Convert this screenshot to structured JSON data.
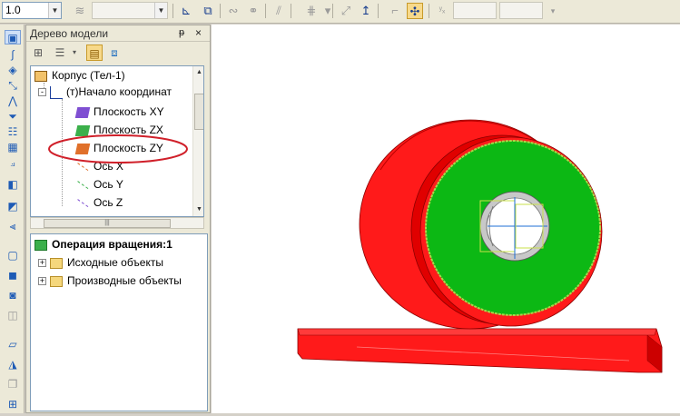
{
  "toolbar": {
    "line_scale_value": "1.0",
    "combo2_value": "",
    "combo3_value": "",
    "icons": [
      "frame-icon",
      "rotate-icon",
      "link-icon",
      "knife-icon",
      "grid-icon",
      "coord-icon",
      "ortho-icon",
      "snap-icon",
      "coord-xy-icon"
    ]
  },
  "panel": {
    "title": "Дерево модели",
    "pin": "ᵽ",
    "close": "×"
  },
  "tree": {
    "root": "Корпус (Тел-1)",
    "origin": "(т)Начало координат",
    "items": [
      {
        "label": "Плоскость XY",
        "color": "#7f4fd2"
      },
      {
        "label": "Плоскость ZX",
        "color": "#3bb04b"
      },
      {
        "label": "Плоскость ZY",
        "color": "#e0702a"
      },
      {
        "label": "Ось X",
        "color": "#e0702a"
      },
      {
        "label": "Ось Y",
        "color": "#3bb04b"
      },
      {
        "label": "Ось Z",
        "color": "#7f4fd2"
      }
    ]
  },
  "operation": {
    "title": "Операция вращения:1",
    "children": [
      "Исходные объекты",
      "Производные объекты"
    ]
  },
  "colors": {
    "part_red": "#ff1a1a",
    "face_green": "#0cb814",
    "highlight_ellipse": "#d0202a"
  }
}
